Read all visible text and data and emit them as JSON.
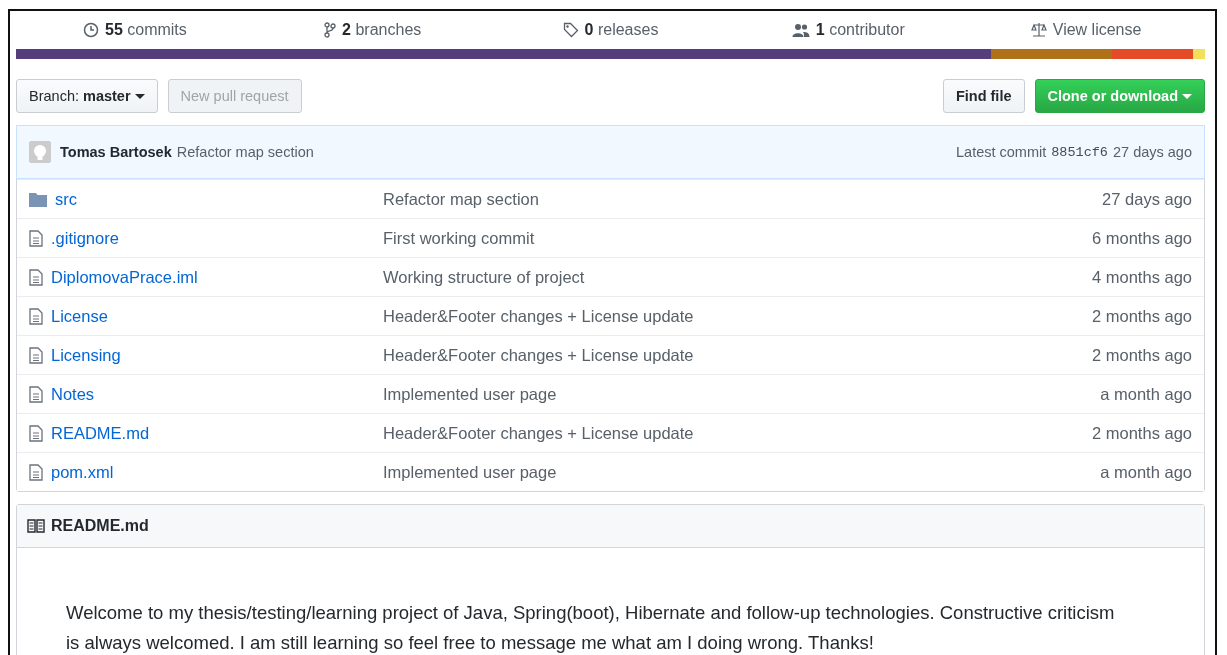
{
  "stats": [
    {
      "kind": "commits",
      "count": "55",
      "label": "commits"
    },
    {
      "kind": "branches",
      "count": "2",
      "label": "branches"
    },
    {
      "kind": "releases",
      "count": "0",
      "label": "releases"
    },
    {
      "kind": "contributors",
      "count": "1",
      "label": "contributor"
    },
    {
      "kind": "license",
      "label": "View license"
    }
  ],
  "languages": [
    {
      "color": "#563d7c"
    },
    {
      "color": "#b07219"
    },
    {
      "color": "#e34c26"
    },
    {
      "color": "#f1e05a"
    }
  ],
  "branch_button": {
    "prefix": "Branch:",
    "name": "master"
  },
  "pull_request_button": {
    "label": "New pull request",
    "disabled": true
  },
  "find_file_button": "Find file",
  "clone_button": "Clone or download",
  "latest_commit": {
    "author": "Tomas Bartosek",
    "message": "Refactor map section",
    "prefix": "Latest commit",
    "sha": "8851cf6",
    "age": "27 days ago"
  },
  "files": [
    {
      "kind": "folder",
      "name": "src",
      "message": "Refactor map section",
      "age": "27 days ago"
    },
    {
      "kind": "file",
      "name": ".gitignore",
      "message": "First working commit",
      "age": "6 months ago"
    },
    {
      "kind": "file",
      "name": "DiplomovaPrace.iml",
      "message": "Working structure of project",
      "age": "4 months ago"
    },
    {
      "kind": "file",
      "name": "License",
      "message": "Header&Footer changes + License update",
      "age": "2 months ago"
    },
    {
      "kind": "file",
      "name": "Licensing",
      "message": "Header&Footer changes + License update",
      "age": "2 months ago"
    },
    {
      "kind": "file",
      "name": "Notes",
      "message": "Implemented user page",
      "age": "a month ago"
    },
    {
      "kind": "file",
      "name": "README.md",
      "message": "Header&Footer changes + License update",
      "age": "2 months ago"
    },
    {
      "kind": "file",
      "name": "pom.xml",
      "message": "Implemented user page",
      "age": "a month ago"
    }
  ],
  "readme": {
    "title": "README.md",
    "text": "Welcome to my thesis/testing/learning project of Java, Spring(boot), Hibernate and follow-up technologies. Constructive criticism is always welcomed. I am still learning so feel free to message me what am I doing wrong. Thanks!"
  }
}
